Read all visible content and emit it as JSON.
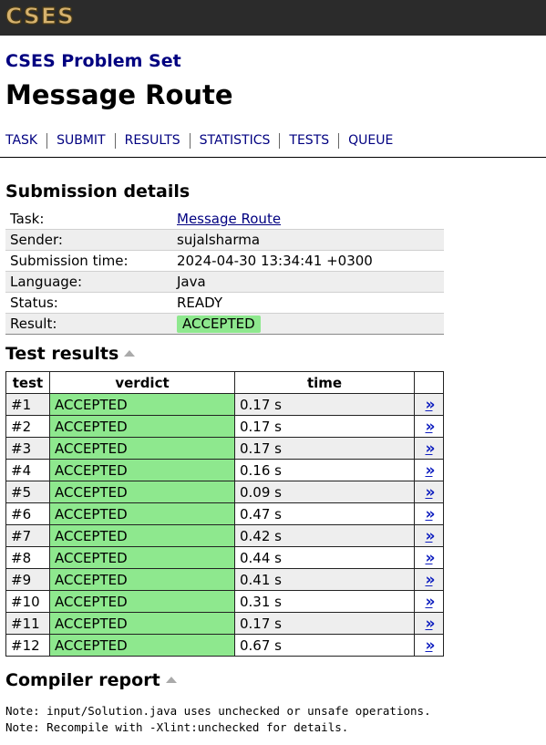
{
  "header": {
    "logo_text": "CSES"
  },
  "site_title": "CSES Problem Set",
  "page_title": "Message Route",
  "nav": [
    "TASK",
    "SUBMIT",
    "RESULTS",
    "STATISTICS",
    "TESTS",
    "QUEUE"
  ],
  "submission": {
    "heading": "Submission details",
    "rows": [
      {
        "label": "Task:",
        "value": "Message Route",
        "link": true
      },
      {
        "label": "Sender:",
        "value": "sujalsharma"
      },
      {
        "label": "Submission time:",
        "value": "2024-04-30 13:34:41 +0300"
      },
      {
        "label": "Language:",
        "value": "Java"
      },
      {
        "label": "Status:",
        "value": "READY"
      },
      {
        "label": "Result:",
        "value": "ACCEPTED",
        "badge": true
      }
    ]
  },
  "tests": {
    "heading": "Test results",
    "columns": [
      "test",
      "verdict",
      "time"
    ],
    "link_text": "»",
    "rows": [
      {
        "test": "#1",
        "verdict": "ACCEPTED",
        "time": "0.17 s"
      },
      {
        "test": "#2",
        "verdict": "ACCEPTED",
        "time": "0.17 s"
      },
      {
        "test": "#3",
        "verdict": "ACCEPTED",
        "time": "0.17 s"
      },
      {
        "test": "#4",
        "verdict": "ACCEPTED",
        "time": "0.16 s"
      },
      {
        "test": "#5",
        "verdict": "ACCEPTED",
        "time": "0.09 s"
      },
      {
        "test": "#6",
        "verdict": "ACCEPTED",
        "time": "0.47 s"
      },
      {
        "test": "#7",
        "verdict": "ACCEPTED",
        "time": "0.42 s"
      },
      {
        "test": "#8",
        "verdict": "ACCEPTED",
        "time": "0.44 s"
      },
      {
        "test": "#9",
        "verdict": "ACCEPTED",
        "time": "0.41 s"
      },
      {
        "test": "#10",
        "verdict": "ACCEPTED",
        "time": "0.31 s"
      },
      {
        "test": "#11",
        "verdict": "ACCEPTED",
        "time": "0.17 s"
      },
      {
        "test": "#12",
        "verdict": "ACCEPTED",
        "time": "0.67 s"
      }
    ]
  },
  "compiler": {
    "heading": "Compiler report",
    "lines": [
      "Note: input/Solution.java uses unchecked or unsafe operations.",
      "Note: Recompile with -Xlint:unchecked for details."
    ]
  },
  "colors": {
    "accepted": "#8ee88e",
    "link": "#000080",
    "topbar": "#2b2b2b",
    "logo": "#d6b26e"
  }
}
